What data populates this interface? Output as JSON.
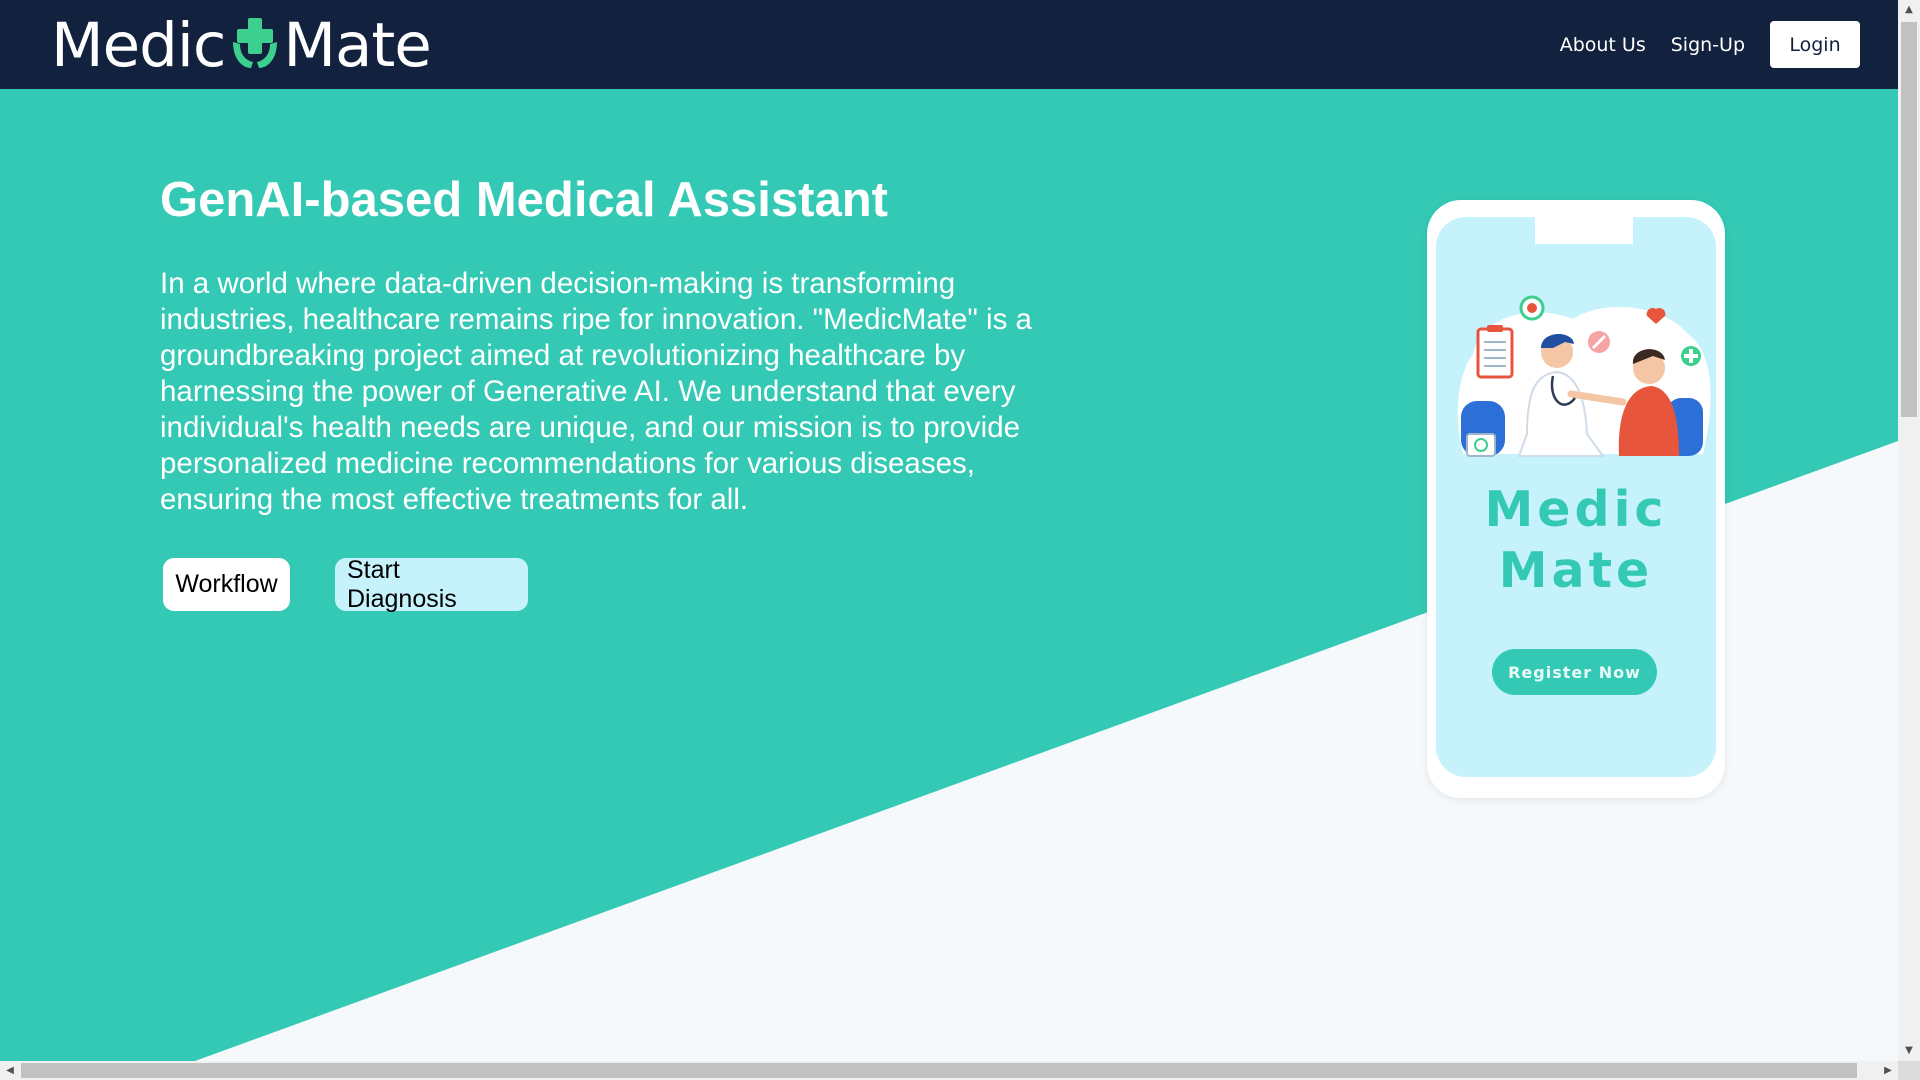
{
  "brand": {
    "name_left": "Medic",
    "name_right": "Mate",
    "logo_icon": "medical-cross-hands-icon"
  },
  "nav": {
    "about": "About Us",
    "signup": "Sign-Up",
    "login": "Login"
  },
  "hero": {
    "title": "GenAI-based Medical Assistant",
    "description": "In a world where data-driven decision-making is transforming industries, healthcare remains ripe for innovation. \"MedicMate\" is a groundbreaking project aimed at revolutionizing healthcare by harnessing the power of Generative AI. We understand that every individual's health needs are unique, and our mission is to provide personalized medicine recommendations for various diseases, ensuring the most effective treatments for all.",
    "buttons": {
      "workflow": "Workflow",
      "start_diagnosis": "Start Diagnosis"
    }
  },
  "phone_mockup": {
    "brand_line1": "Medic",
    "brand_line2": "Mate",
    "register": "Register Now",
    "illustration": "doctor-patient-illustration"
  },
  "colors": {
    "navbar": "#12213d",
    "hero_teal": "#34c9b4",
    "hero_light": "#f6f9fc",
    "phone_screen": "#c6f2fb",
    "diagnosis_button": "#c6f2fb",
    "accent_red": "#e8553d"
  },
  "scrollbars": {
    "vertical_arrow_up": "▲",
    "vertical_arrow_down": "▼",
    "horizontal_arrow_left": "◀",
    "horizontal_arrow_right": "▶"
  }
}
